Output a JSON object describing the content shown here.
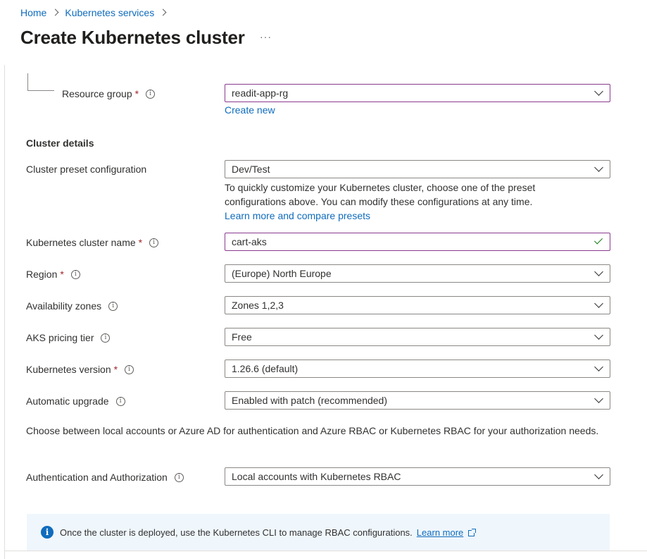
{
  "breadcrumb": {
    "items": [
      "Home",
      "Kubernetes services"
    ]
  },
  "header": {
    "title": "Create Kubernetes cluster",
    "more_label": "···"
  },
  "resource_group": {
    "label": "Resource group",
    "required_mark": "*",
    "value": "readit-app-rg",
    "create_new": "Create new"
  },
  "cluster_details": {
    "title": "Cluster details",
    "preset": {
      "label": "Cluster preset configuration",
      "value": "Dev/Test",
      "help_line1": "To quickly customize your Kubernetes cluster, choose one of the preset",
      "help_line2": "configurations above. You can modify these configurations at any time.",
      "learn_more": "Learn more and compare presets"
    },
    "name": {
      "label": "Kubernetes cluster name",
      "required_mark": "*",
      "value": "cart-aks"
    },
    "region": {
      "label": "Region",
      "required_mark": "*",
      "value": "(Europe) North Europe"
    },
    "zones": {
      "label": "Availability zones",
      "value": "Zones 1,2,3"
    },
    "pricing": {
      "label": "AKS pricing tier",
      "value": "Free"
    },
    "version": {
      "label": "Kubernetes version",
      "required_mark": "*",
      "value": "1.26.6 (default)"
    },
    "upgrade": {
      "label": "Automatic upgrade",
      "value": "Enabled with patch (recommended)"
    }
  },
  "auth": {
    "description": "Choose between local accounts or Azure AD for authentication and Azure RBAC or Kubernetes RBAC for your authorization needs.",
    "label": "Authentication and Authorization",
    "value": "Local accounts with Kubernetes RBAC"
  },
  "info_banner": {
    "icon": "info-icon",
    "text": "Once the cluster is deployed, use the Kubernetes CLI to manage RBAC configurations.",
    "learn_more": "Learn more"
  },
  "colors": {
    "accent": "#0f6cbd",
    "required": "#a4262c",
    "focus_border": "#8a3a8f",
    "valid_check": "#107c10",
    "banner_bg": "#eff6fc"
  }
}
